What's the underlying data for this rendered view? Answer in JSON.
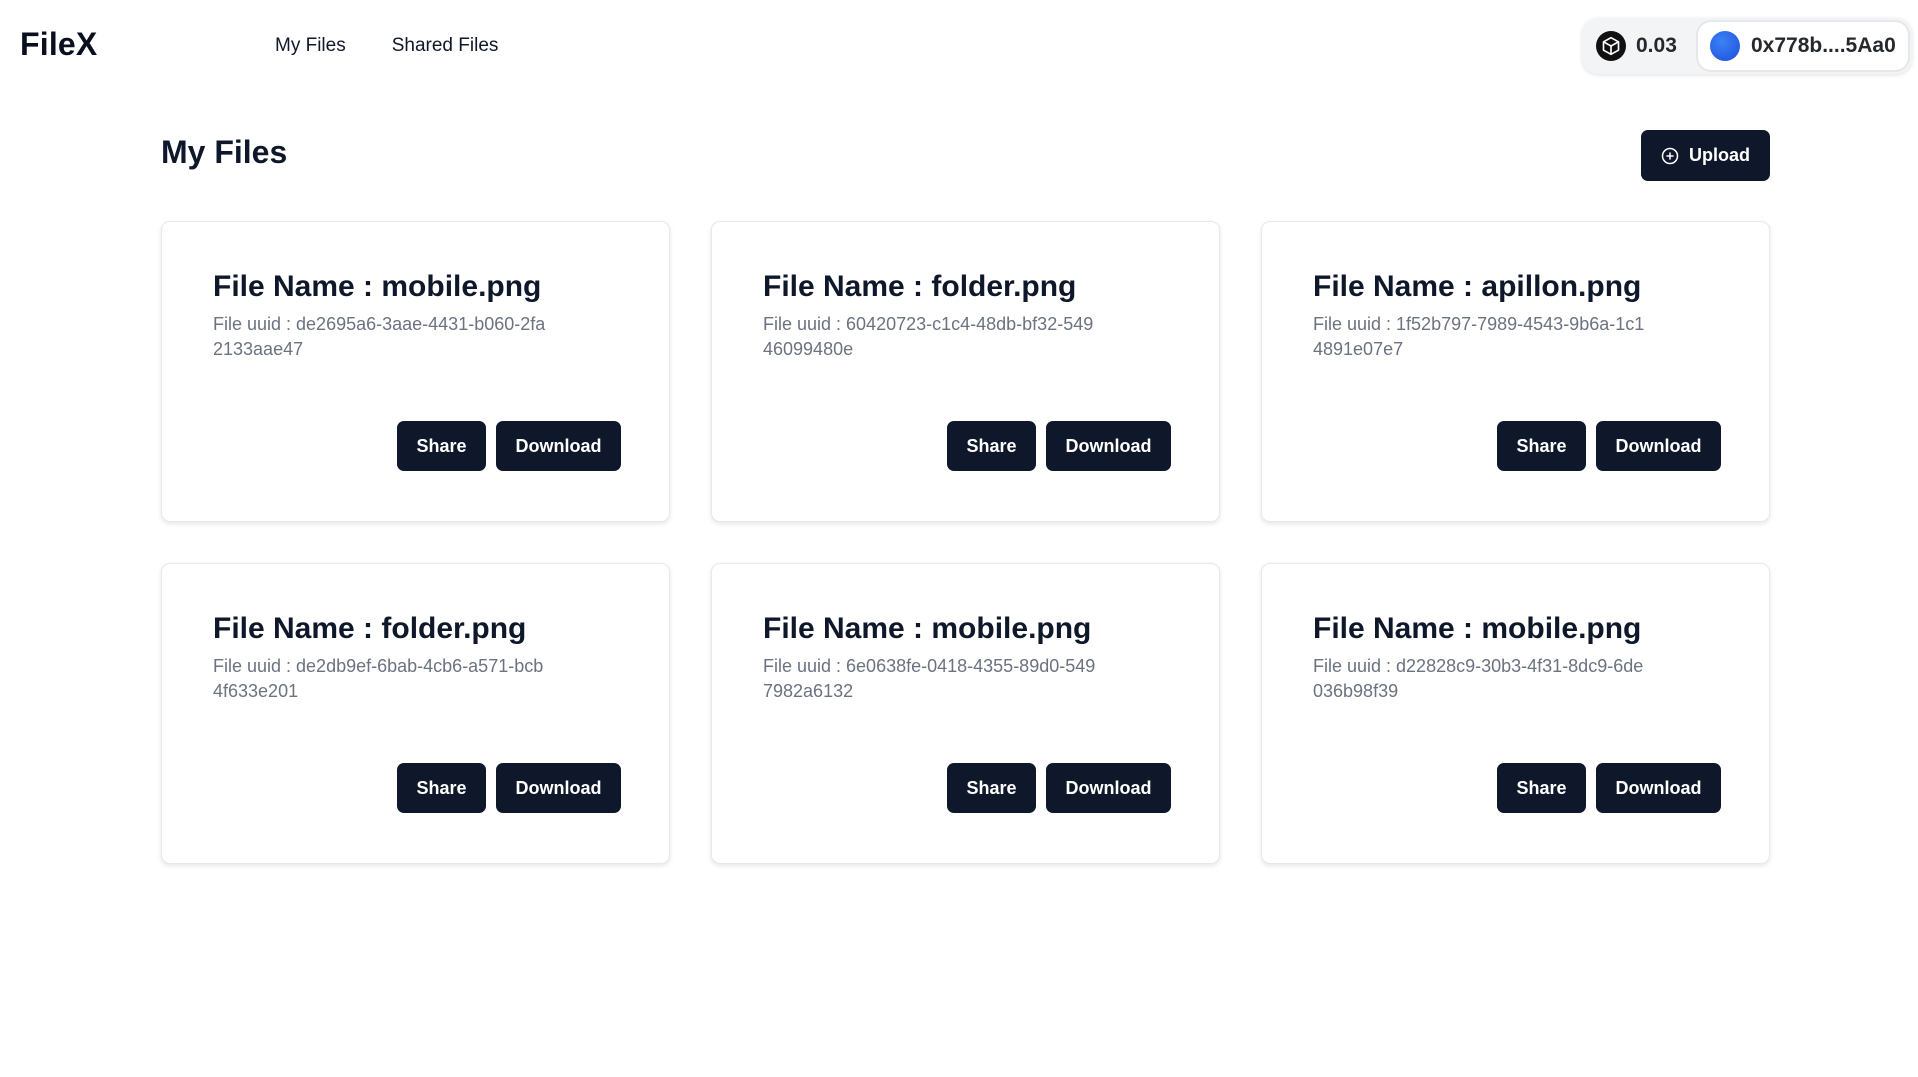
{
  "header": {
    "logo": "FileX",
    "nav": [
      {
        "label": "My Files"
      },
      {
        "label": "Shared Files"
      }
    ],
    "wallet": {
      "balance": "0.03",
      "chain_icon": "cube-icon",
      "account": "0x778b....5Aa0",
      "avatar_color": "#2563eb"
    }
  },
  "main": {
    "title": "My Files",
    "upload_label": "Upload",
    "upload_icon": "plus-circle-icon",
    "share_label": "Share",
    "download_label": "Download",
    "files": [
      {
        "title": "File Name : mobile.png",
        "uuid": "File uuid : de2695a6-3aae-4431-b060-2fa2133aae47"
      },
      {
        "title": "File Name : folder.png",
        "uuid": "File uuid : 60420723-c1c4-48db-bf32-54946099480e"
      },
      {
        "title": "File Name : apillon.png",
        "uuid": "File uuid : 1f52b797-7989-4543-9b6a-1c14891e07e7"
      },
      {
        "title": "File Name : folder.png",
        "uuid": "File uuid : de2db9ef-6bab-4cb6-a571-bcb4f633e201"
      },
      {
        "title": "File Name : mobile.png",
        "uuid": "File uuid : 6e0638fe-0418-4355-89d0-5497982a6132"
      },
      {
        "title": "File Name : mobile.png",
        "uuid": "File uuid : d22828c9-30b3-4f31-8dc9-6de036b98f39"
      }
    ]
  },
  "colors": {
    "primary": "#0f172a",
    "muted_text": "#6b7280",
    "background": "#ffffff"
  }
}
